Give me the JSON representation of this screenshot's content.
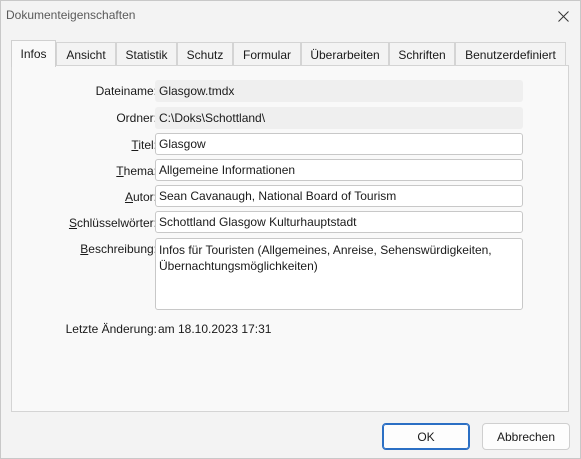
{
  "window": {
    "title": "Dokumenteigenschaften"
  },
  "tabs": [
    {
      "label": "Infos",
      "active": true
    },
    {
      "label": "Ansicht"
    },
    {
      "label": "Statistik"
    },
    {
      "label": "Schutz"
    },
    {
      "label": "Formular"
    },
    {
      "label": "Überarbeiten"
    },
    {
      "label": "Schriften"
    },
    {
      "label": "Benutzerdefiniert"
    }
  ],
  "info": {
    "filename_label": "Dateiname:",
    "filename_value": "Glasgow.tmdx",
    "folder_label": "Ordner:",
    "folder_value": "C:\\Doks\\Schottland\\",
    "title_label_pre": "",
    "title_label_u": "T",
    "title_label_post": "itel:",
    "title_value": "Glasgow",
    "subject_label_pre": "",
    "subject_label_u": "T",
    "subject_label_post": "hema:",
    "subject_value": "Allgemeine Informationen",
    "author_label_pre": "",
    "author_label_u": "A",
    "author_label_post": "utor:",
    "author_value": "Sean Cavanaugh, National Board of Tourism",
    "keywords_label_pre": "",
    "keywords_label_u": "S",
    "keywords_label_post": "chlüsselwörter:",
    "keywords_value": "Schottland Glasgow Kulturhauptstadt",
    "description_label_pre": "",
    "description_label_u": "B",
    "description_label_post": "eschreibung:",
    "description_value": "Infos für Touristen (Allgemeines, Anreise, Sehenswürdigkeiten, Übernachtungsmöglichkeiten)",
    "last_change_label": "Letzte Änderung:",
    "last_change_value": "am 18.10.2023 17:31"
  },
  "buttons": {
    "ok": "OK",
    "cancel": "Abbrechen"
  },
  "colors": {
    "accent": "#2b6fc4",
    "window_bg": "#f3f3f3",
    "panel_bg": "#f9f9f9"
  },
  "icons": {
    "close": "close-icon"
  }
}
